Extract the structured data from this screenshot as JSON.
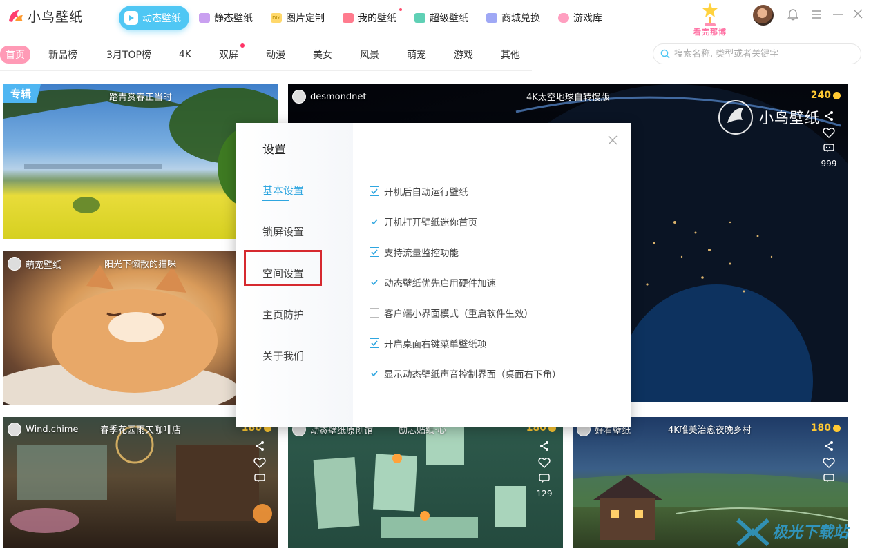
{
  "app": {
    "name": "小鸟壁纸"
  },
  "nav": {
    "items": [
      {
        "label": "动态壁纸",
        "icon": "play-icon",
        "active": true
      },
      {
        "label": "静态壁纸",
        "icon": "image-icon"
      },
      {
        "label": "图片定制",
        "icon": "diy-icon"
      },
      {
        "label": "我的壁纸",
        "icon": "user-icon",
        "dot": true
      },
      {
        "label": "超级壁纸",
        "icon": "star-icon"
      },
      {
        "label": "商城兑换",
        "icon": "cart-icon"
      },
      {
        "label": "游戏库",
        "icon": "gamepad-icon"
      }
    ],
    "rank_badge": "看完那博"
  },
  "categories": {
    "items": [
      "首页",
      "新品榜",
      "3月TOP榜",
      "4K",
      "双屏",
      "动漫",
      "美女",
      "风景",
      "萌宠",
      "游戏",
      "其他"
    ],
    "active": "首页"
  },
  "search": {
    "placeholder": "搜索名称, 类型或者关键字"
  },
  "cards": {
    "c1": {
      "badge": "专辑",
      "title": "踏青赏春正当时"
    },
    "c2": {
      "author": "desmondnet",
      "title": "4K太空地球自转慢版",
      "price": "240",
      "brand": "小鸟壁纸",
      "comments": "999"
    },
    "c3": {
      "author": "萌宠壁纸",
      "title": "阳光下懒散的猫咪"
    },
    "c4": {
      "author": "Wind.chime",
      "title": "春季花园雨天咖啡店",
      "price": "180"
    },
    "c5": {
      "author": "动态壁纸原创馆",
      "title": "励志贴纸·心",
      "price": "180",
      "comments": "129"
    },
    "c6": {
      "author": "好看壁纸",
      "title": "4K唯美治愈夜晚乡村",
      "price": "180"
    }
  },
  "settings": {
    "title": "设置",
    "close": "×",
    "menu": [
      "基本设置",
      "锁屏设置",
      "空间设置",
      "主页防护",
      "关于我们"
    ],
    "active": "基本设置",
    "highlighted": "空间设置",
    "options": [
      {
        "label": "开机后自动运行壁纸",
        "checked": true
      },
      {
        "label": "开机打开壁纸迷你首页",
        "checked": true
      },
      {
        "label": "支持流量监控功能",
        "checked": true
      },
      {
        "label": "动态壁纸优先启用硬件加速",
        "checked": true
      },
      {
        "label": "客户端小界面模式（重启软件生效）",
        "checked": false
      },
      {
        "label": "开启桌面右键菜单壁纸项",
        "checked": true
      },
      {
        "label": "显示动态壁纸声音控制界面（桌面右下角）",
        "checked": true
      }
    ]
  },
  "watermark": {
    "text": "极光下载站"
  },
  "colors": {
    "accent": "#4fc7f4",
    "highlight_box": "#d6292f",
    "price": "#ffc933",
    "category_active": "#ff9ab6"
  }
}
